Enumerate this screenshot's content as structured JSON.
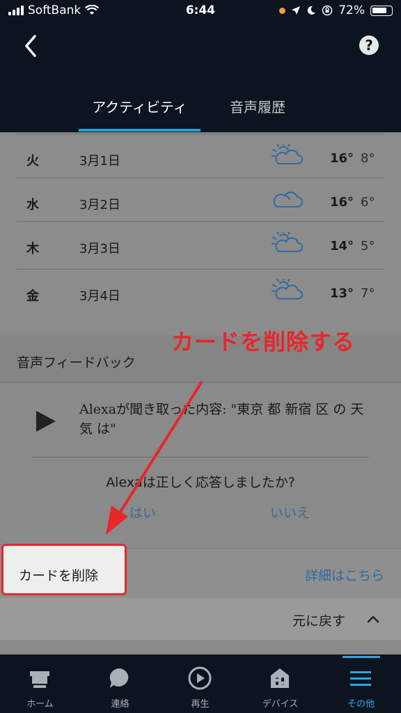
{
  "status_bar": {
    "carrier": "SoftBank",
    "time": "6:44",
    "battery": "72%"
  },
  "header": {
    "help_label": "?",
    "tabs": [
      {
        "label": "アクティビティ",
        "active": true
      },
      {
        "label": "音声履歴",
        "active": false
      }
    ]
  },
  "weather": {
    "rows": [
      {
        "day": "火",
        "date": "3月1日",
        "icon": "sun-cloud-icon",
        "high": "16°",
        "low": "8°"
      },
      {
        "day": "水",
        "date": "3月2日",
        "icon": "cloud-icon",
        "high": "16°",
        "low": "6°"
      },
      {
        "day": "木",
        "date": "3月3日",
        "icon": "sun-cloud-icon",
        "high": "14°",
        "low": "5°"
      },
      {
        "day": "金",
        "date": "3月4日",
        "icon": "sun-cloud-icon",
        "high": "13°",
        "low": "7°"
      }
    ]
  },
  "feedback": {
    "title": "音声フィードバック",
    "heard_text": "Alexaが聞き取った内容: \"東京 都 新宿 区 の 天気 は\"",
    "question": "Alexaは正しく応答しましたか?",
    "yes": "はい",
    "no": "いいえ"
  },
  "card_actions": {
    "delete_label": "カードを削除",
    "details_label": "詳細はこちら",
    "undo_label": "元に戻す"
  },
  "annotation": {
    "text": "カードを削除する",
    "color": "#e8262b"
  },
  "bottom_nav": [
    {
      "label": "ホーム",
      "icon": "home-icon",
      "active": false
    },
    {
      "label": "連絡",
      "icon": "chat-icon",
      "active": false
    },
    {
      "label": "再生",
      "icon": "play-icon",
      "active": false
    },
    {
      "label": "デバイス",
      "icon": "devices-icon",
      "active": false
    },
    {
      "label": "その他",
      "icon": "menu-icon",
      "active": true
    }
  ],
  "colors": {
    "header_bg": "#0c1420",
    "accent": "#2aa6e6",
    "link": "#2e6aa2"
  }
}
